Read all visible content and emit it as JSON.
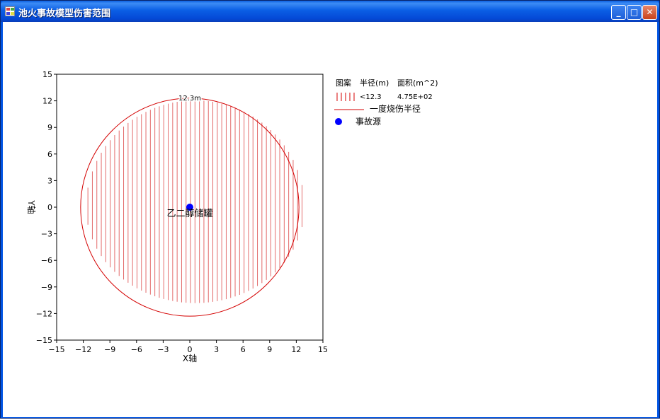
{
  "window": {
    "title": "池火事故模型伤害范围",
    "buttons": {
      "minimize": "_",
      "maximize": "□",
      "close": "✕"
    },
    "icons": {
      "app": "app-icon",
      "minimize": "minimize-icon",
      "maximize": "maximize-icon",
      "close": "close-icon"
    }
  },
  "chart_data": {
    "type": "scatter",
    "xlabel": "X轴",
    "ylabel": "Y轴",
    "xlim": [
      -15,
      15
    ],
    "ylim": [
      -15,
      15
    ],
    "xticks": [
      -15,
      -12,
      -9,
      -6,
      -3,
      0,
      3,
      6,
      9,
      12,
      15
    ],
    "yticks": [
      -15,
      -12,
      -9,
      -6,
      -3,
      0,
      3,
      6,
      9,
      12,
      15
    ],
    "xtick_labels": [
      "−15",
      "−12",
      "−9",
      "−6",
      "−3",
      "0",
      "3",
      "6",
      "9",
      "12",
      "15"
    ],
    "ytick_labels": [
      "−15",
      "−12",
      "−9",
      "−6",
      "−3",
      "0",
      "3",
      "6",
      "9",
      "12",
      "15"
    ],
    "grid": false,
    "circle": {
      "center": [
        0,
        0
      ],
      "radius": 12.3,
      "color": "#d40000",
      "label": "12.3m"
    },
    "source": {
      "x": 0,
      "y": 0,
      "label": "乙二醇储罐",
      "color": "#0000ff"
    },
    "legend": {
      "placement": "right",
      "header": [
        "图案",
        "半径(m)",
        "面积(m^2)"
      ],
      "rows": [
        {
          "symbol": "hatch",
          "radius": "<12.3",
          "area": "4.75E+02",
          "color": "#d40000"
        },
        {
          "symbol": "line",
          "label": "一度烧伤半径",
          "color": "#d40000"
        },
        {
          "symbol": "dot",
          "label": "事故源",
          "color": "#0000ff"
        }
      ]
    }
  }
}
